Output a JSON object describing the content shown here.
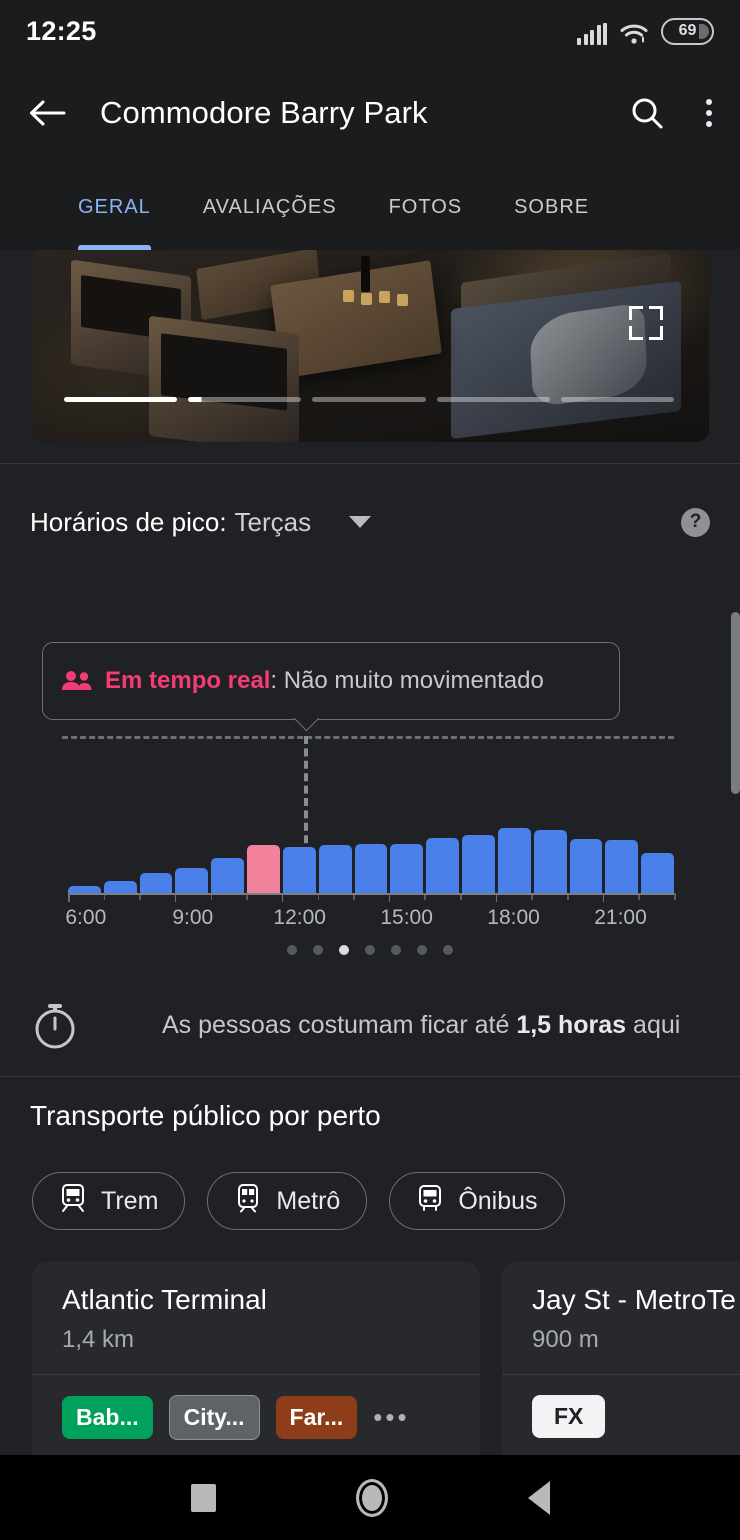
{
  "status_bar": {
    "clock": "12:25",
    "battery_level": "69",
    "signal_icon": "signal-bars-icon",
    "wifi_icon": "wifi-icon"
  },
  "app_bar": {
    "back_icon": "back-arrow-icon",
    "title": "Commodore Barry Park",
    "search_icon": "search-icon",
    "overflow_icon": "more-vertical-icon"
  },
  "tabs": [
    {
      "label": "GERAL",
      "active": true
    },
    {
      "label": "AVALIAÇÕES",
      "active": false
    },
    {
      "label": "FOTOS",
      "active": false
    },
    {
      "label": "SOBRE",
      "active": false
    }
  ],
  "photo_carousel": {
    "fullscreen_icon": "fullscreen-expand-icon",
    "segments": 5,
    "active_segment": 1,
    "progress_within_segment": 1.0
  },
  "popular_times": {
    "title": "Horários de pico:",
    "day": "Terças",
    "dropdown_icon": "chevron-down-icon",
    "help_icon": "help-circle-icon",
    "help_label": "?",
    "live_icon": "people-icon",
    "live_label": "Em tempo real",
    "live_status": ": Não muito movimentado",
    "pagination_dots": 7,
    "pagination_active_index": 2
  },
  "chart_data": {
    "type": "bar",
    "title": "Horários de pico: Terças",
    "xlabel": "",
    "ylabel": "",
    "categories": [
      "6:00",
      "7:00",
      "8:00",
      "9:00",
      "10:00",
      "11:00",
      "12:00",
      "13:00",
      "14:00",
      "15:00",
      "16:00",
      "17:00",
      "18:00",
      "19:00",
      "20:00",
      "21:00",
      "22:00"
    ],
    "values": [
      8,
      14,
      22,
      28,
      38,
      52,
      50,
      52,
      53,
      53,
      60,
      63,
      70,
      68,
      58,
      57,
      44
    ],
    "tick_labels": [
      "6:00",
      "9:00",
      "12:00",
      "15:00",
      "18:00",
      "21:00"
    ],
    "tick_indices": [
      0,
      3,
      6,
      9,
      12,
      15
    ],
    "highlight_index": 5,
    "highlight_label": "Em tempo real: Não muito movimentado",
    "bar_color": "#4a80ea",
    "highlight_color": "#f2819c",
    "ylim": [
      0,
      100
    ],
    "grid": false,
    "legend": "none"
  },
  "spend_time": {
    "icon": "timer-icon",
    "text_before": "As pessoas costumam ficar até ",
    "duration": "1,5 horas",
    "text_after": " aqui"
  },
  "transit": {
    "title": "Transporte público por perto",
    "chips": [
      {
        "label": "Trem",
        "icon": "train-icon"
      },
      {
        "label": "Metrô",
        "icon": "subway-icon"
      },
      {
        "label": "Ônibus",
        "icon": "bus-icon"
      }
    ],
    "stations": [
      {
        "name": "Atlantic Terminal",
        "distance": "1,4 km",
        "lines": [
          {
            "label": "Bab...",
            "color": "#00A15C",
            "outline": false
          },
          {
            "label": "City...",
            "color": "#5f6368",
            "outline": true
          },
          {
            "label": "Far...",
            "color": "#8e3d19",
            "outline": false
          }
        ],
        "more": "•••"
      },
      {
        "name": "Jay St - MetroTe",
        "distance": "900 m",
        "lines": [
          {
            "label": "FX",
            "color": "#f1f3f4",
            "outline": false,
            "text_dark": true
          }
        ],
        "more": ""
      }
    ]
  },
  "nav_bar": {
    "recents_icon": "square-recents-icon",
    "home_icon": "circle-home-icon",
    "back_icon": "triangle-back-icon"
  },
  "theme": {
    "background": "#202124",
    "surface": "#1b1c1e",
    "card": "#28292c",
    "accent_blue": "#8ab4f8",
    "bar_blue": "#4a80ea",
    "live_pink": "#f53b74"
  }
}
